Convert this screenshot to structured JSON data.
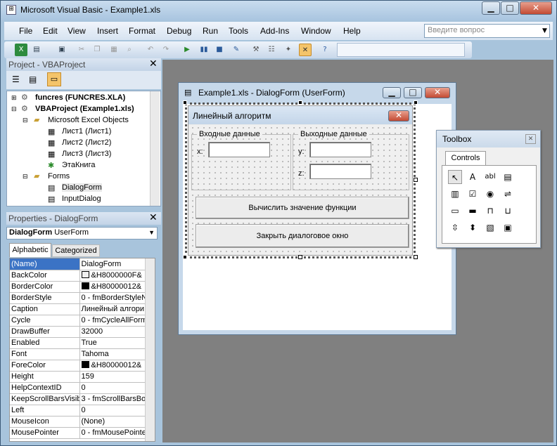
{
  "window": {
    "title": "Microsoft Visual Basic - Example1.xls",
    "min": "▁",
    "max": "□",
    "close": "✕"
  },
  "menu": [
    "File",
    "Edit",
    "View",
    "Insert",
    "Format",
    "Debug",
    "Run",
    "Tools",
    "Add-Ins",
    "Window",
    "Help"
  ],
  "help_box": {
    "placeholder": "Введите вопрос"
  },
  "project": {
    "title": "Project - VBAProject",
    "close": "✕",
    "tree": [
      "funcres (FUNCRES.XLA)",
      "VBAProject (Example1.xls)",
      "Microsoft Excel Objects",
      "Лист1 (Лист1)",
      "Лист2 (Лист2)",
      "Лист3 (Лист3)",
      "ЭтаКнига",
      "Forms",
      "DialogForm",
      "InputDialog"
    ]
  },
  "properties": {
    "title": "Properties - DialogForm",
    "close": "✕",
    "object": {
      "name": "DialogForm",
      "type": "UserForm"
    },
    "tabs": [
      "Alphabetic",
      "Categorized"
    ],
    "rows": [
      {
        "name": "(Name)",
        "value": "DialogForm"
      },
      {
        "name": "BackColor",
        "value": "&H8000000F&"
      },
      {
        "name": "BorderColor",
        "value": "&H80000012&"
      },
      {
        "name": "BorderStyle",
        "value": "0 - fmBorderStyleN"
      },
      {
        "name": "Caption",
        "value": "Линейный алгори"
      },
      {
        "name": "Cycle",
        "value": "0 - fmCycleAllForm"
      },
      {
        "name": "DrawBuffer",
        "value": "32000"
      },
      {
        "name": "Enabled",
        "value": "True"
      },
      {
        "name": "Font",
        "value": "Tahoma"
      },
      {
        "name": "ForeColor",
        "value": "&H80000012&"
      },
      {
        "name": "Height",
        "value": "159"
      },
      {
        "name": "HelpContextID",
        "value": "0"
      },
      {
        "name": "KeepScrollBarsVisible",
        "value": "3 - fmScrollBarsBot"
      },
      {
        "name": "Left",
        "value": "0"
      },
      {
        "name": "MouseIcon",
        "value": "(None)"
      },
      {
        "name": "MousePointer",
        "value": "0 - fmMousePointe"
      }
    ]
  },
  "designer": {
    "title": "Example1.xls - DialogForm (UserForm)",
    "form_caption": "Линейный алгоритм",
    "frame_in": "Входные данные",
    "frame_out": "Выходные данные",
    "label_x": "x:",
    "label_y": "y:",
    "label_z": "z:",
    "btn_calc": "Вычислить значение функции",
    "btn_close": "Закрыть диалоговое окно"
  },
  "toolbox": {
    "title": "Toolbox",
    "tab": "Controls",
    "close": "✕",
    "icons": [
      "pointer-icon",
      "label-icon",
      "textbox-icon",
      "combobox-icon",
      "listbox-icon",
      "checkbox-icon",
      "optionbutton-icon",
      "togglebutton-icon",
      "frame-icon",
      "commandbutton-icon",
      "tabstrip-icon",
      "multipage-icon",
      "scrollbar-icon",
      "spinbutton-icon",
      "image-icon",
      "refedit-icon"
    ],
    "glyphs": [
      "↖",
      "A",
      "abl",
      "▤",
      "▥",
      "☑",
      "◉",
      "⇌",
      "▭",
      "▬",
      "⊓",
      "⊔",
      "⇳",
      "⬍",
      "▧",
      "▣"
    ]
  }
}
